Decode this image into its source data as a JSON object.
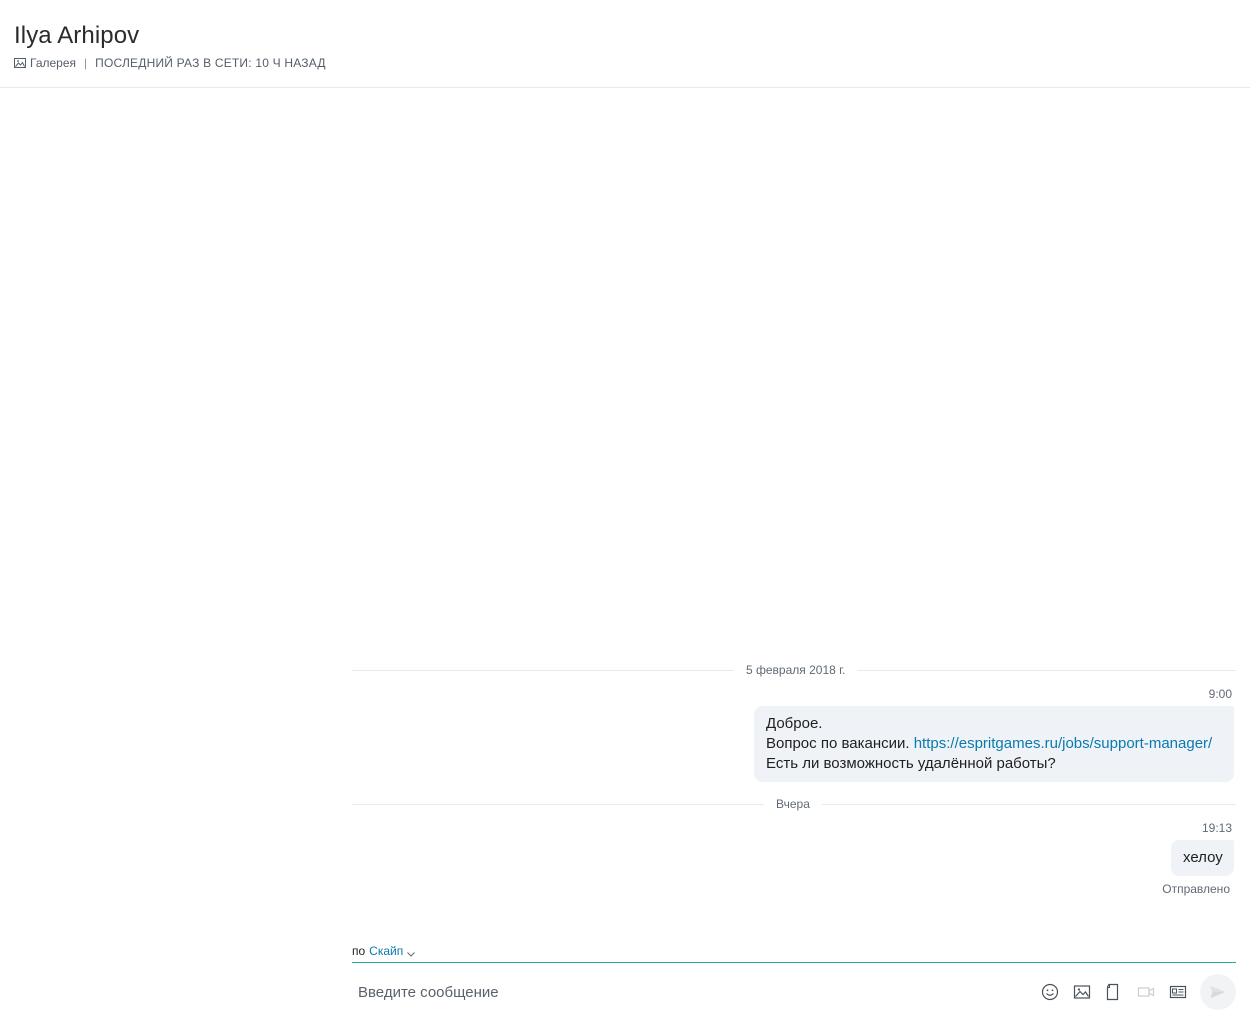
{
  "header": {
    "contact_name": "Ilya Arhipov",
    "gallery_label": "Галерея",
    "separator": "|",
    "last_seen": "ПОСЛЕДНИЙ РАЗ В СЕТИ: 10 Ч НАЗАД"
  },
  "conversation": {
    "groups": [
      {
        "date_label": "5 февраля 2018 г.",
        "time": "9:00",
        "lines": {
          "line1": "Доброе.",
          "line2_prefix": "Вопрос по вакансии. ",
          "line2_link": "https://espritgames.ru/jobs/support-manager/",
          "line3": "Есть ли возможность удалённой работы?"
        }
      },
      {
        "date_label": "Вчера",
        "time": "19:13",
        "text": "хелоу",
        "status": "Отправлено"
      }
    ]
  },
  "composer": {
    "via_prefix": "по",
    "via_service": "Скайп",
    "placeholder": "Введите сообщение"
  },
  "icons": {
    "gallery": "image-icon",
    "emoji": "emoji-icon",
    "image": "image-icon",
    "file": "file-icon",
    "video": "video-message-icon",
    "contact": "contact-card-icon",
    "send": "send-icon"
  },
  "colors": {
    "link": "#0a7aad",
    "bubble": "#eff3f8",
    "input_underline": "#25a8a0"
  }
}
